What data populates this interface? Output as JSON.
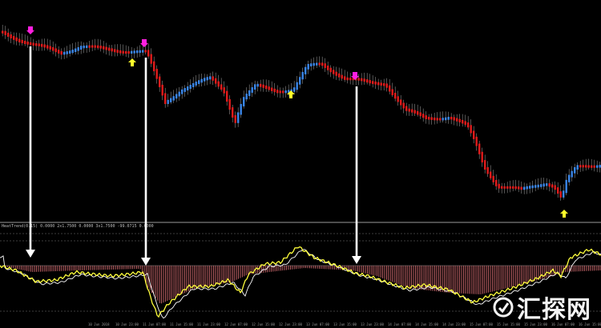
{
  "indicator": {
    "caption": "HeatTrend(0.15) 0.0000 2x1.7500 0.0000 3x1.7500 -99.0715 0.0000"
  },
  "time_axis": {
    "labels": [
      "10 Jun 2018",
      "10 Jun 23:00",
      "11 Jun 07:00",
      "11 Jun 15:00",
      "11 Jun 23:00",
      "12 Jun 07:00",
      "12 Jun 15:00",
      "12 Jun 23:00",
      "13 Jun 07:00",
      "13 Jun 15:00",
      "13 Jun 23:00",
      "14 Jun 07:00",
      "14 Jun 15:00",
      "14 Jun 23:00",
      "15 Jun 07:00",
      "15 Jun 15:00",
      "15 Jun 23:00",
      "16 Jun 07:00",
      "16 Jun 15:00",
      "16 Jun 23:00"
    ]
  },
  "watermark": {
    "text": "汇探网"
  },
  "colors": {
    "bull": "#3a86e8",
    "bear": "#e01b1b",
    "sell_arrow": "#ff1fe0",
    "buy_arrow": "#ffff2a",
    "histogram": "#d46d72",
    "line": "#ffff3c",
    "signal": "#ffffff"
  }
}
